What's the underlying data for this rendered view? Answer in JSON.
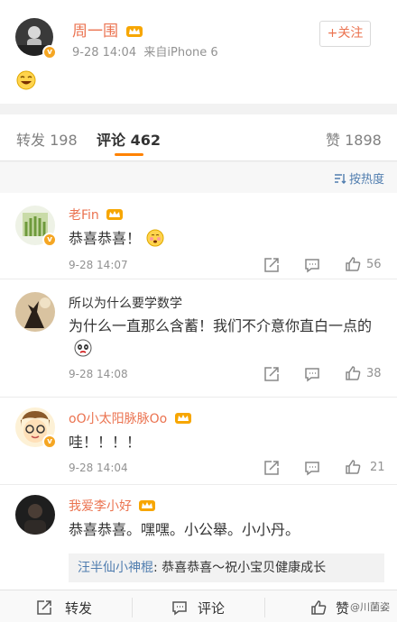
{
  "post": {
    "author": "周一围",
    "time": "9-28 14:04",
    "source": "来自iPhone 6",
    "follow_label": "+关注"
  },
  "tabs": {
    "repost": "转发 198",
    "comment": "评论 462",
    "like": "赞 1898"
  },
  "sort_label": "按热度",
  "comments": [
    {
      "name": "老Fin",
      "text": "恭喜恭喜！",
      "time": "9-28 14:07",
      "likes": "56"
    },
    {
      "name": "所以为什么要学数学",
      "text": "为什么一直那么含蓄！我们不介意你直白一点的",
      "time": "9-28 14:08",
      "likes": "38"
    },
    {
      "name": "oO小太阳脉脉Oo",
      "text": "哇！！！！",
      "time": "9-28 14:04",
      "likes": "21"
    },
    {
      "name": "我爱李小好",
      "text": "恭喜恭喜。嘿嘿。小公舉。小小丹。"
    }
  ],
  "reply": {
    "name": "汪半仙小神棍",
    "text": ": 恭喜恭喜～祝小宝贝健康成长"
  },
  "bottom": {
    "repost": "转发",
    "comment": "评论",
    "like": "赞",
    "watermark": "@川菌姿"
  },
  "colors": {
    "accent": "#eb7350",
    "link": "#507daf",
    "tab_underline": "#ff8200"
  }
}
